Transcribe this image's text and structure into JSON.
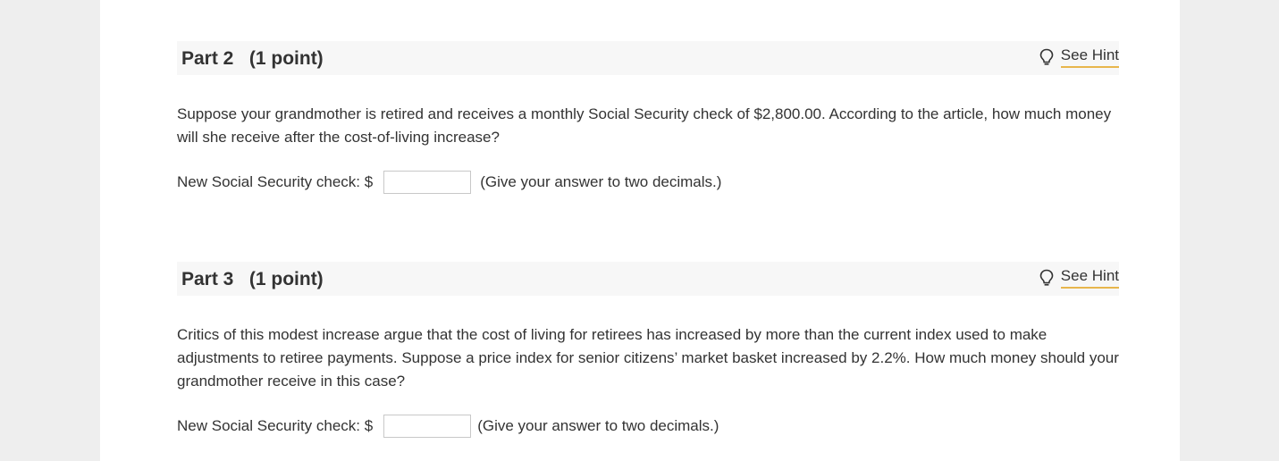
{
  "parts": [
    {
      "title": "Part 2   (1 point)",
      "hint_label": "See Hint",
      "question": "Suppose your grandmother is retired and receives a monthly Social Security check of $2,800.00. According to the article, how much money will she receive after the cost-of-living increase?",
      "answer_label": "New Social Security check: $",
      "answer_value": "",
      "answer_note": "(Give your answer to two decimals.)"
    },
    {
      "title": "Part 3   (1 point)",
      "hint_label": "See Hint",
      "question": "Critics of this modest increase argue that the cost of living for retirees has increased by more than the current index used to make adjustments to retiree payments. Suppose a price index for senior citizens’ market basket increased by 2.2%. How much money should your grandmother receive in this case?",
      "answer_label": "New Social Security check: $",
      "answer_value": "",
      "answer_note": "(Give your answer to two decimals.)"
    }
  ],
  "colors": {
    "background": "#eeeeee",
    "panel": "#ffffff",
    "header": "#f7f7f7",
    "hint_underline": "#e8b64c",
    "text": "#333333"
  },
  "icons": {
    "hint": "lightbulb-icon"
  }
}
